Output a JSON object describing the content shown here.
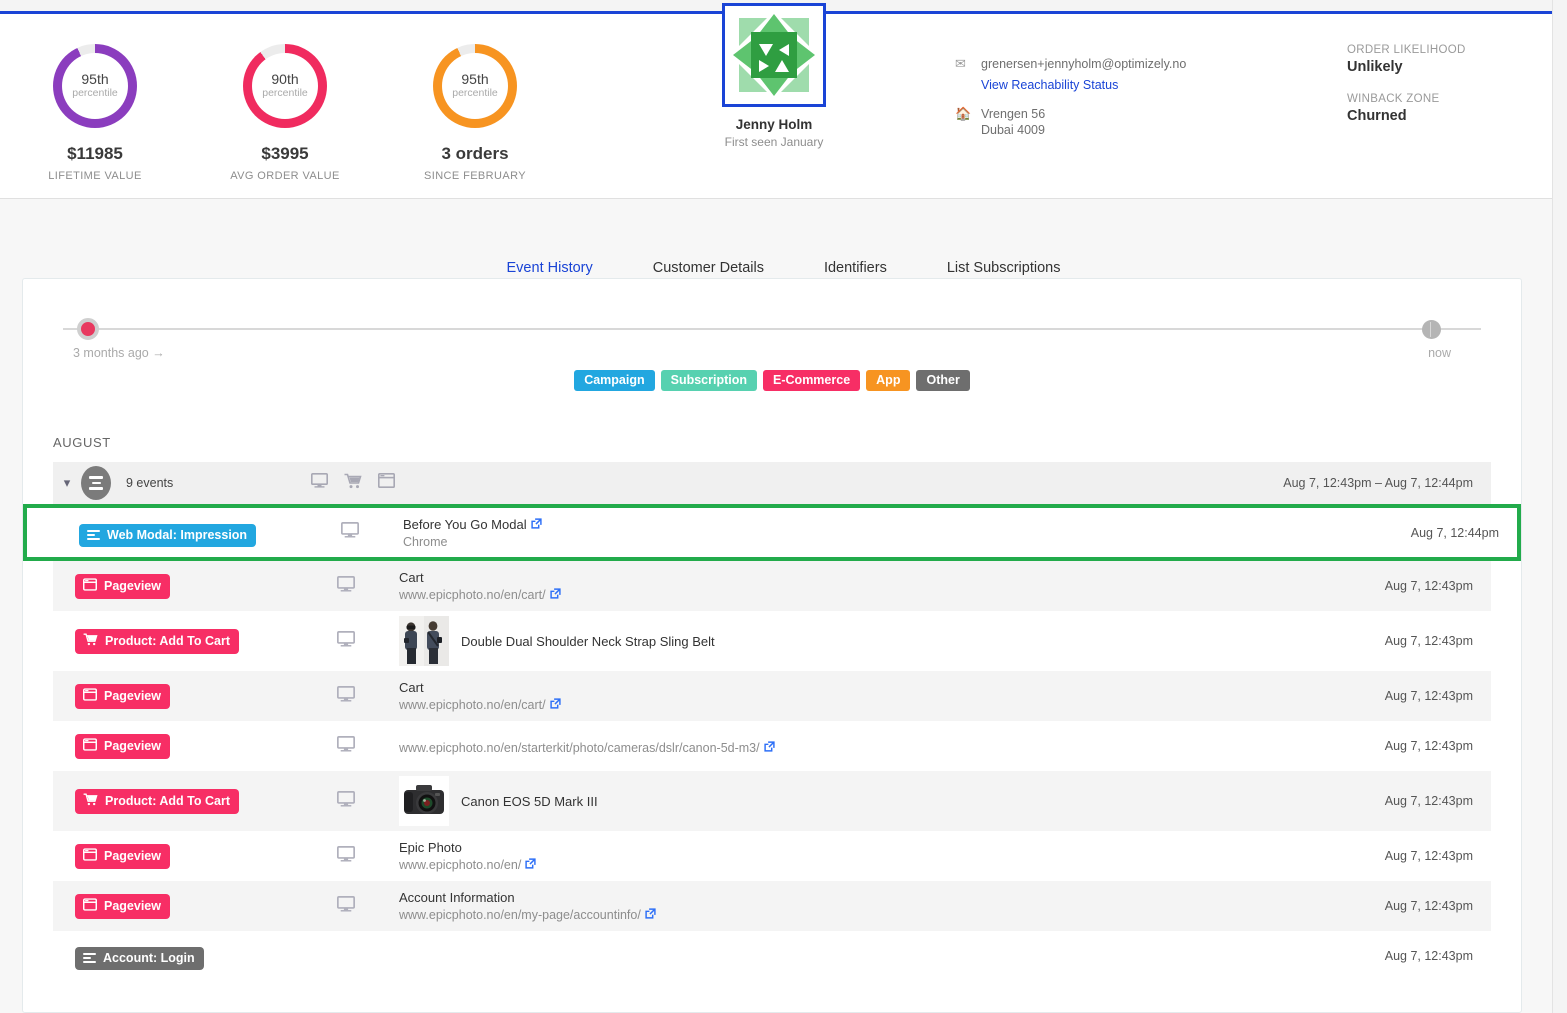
{
  "header": {
    "metrics": [
      {
        "pct": "95th",
        "pct_sub": "percentile",
        "value": "$11985",
        "caption": "LIFETIME VALUE",
        "color": "#8B3DBE",
        "fill": 0.93
      },
      {
        "pct": "90th",
        "pct_sub": "percentile",
        "value": "$3995",
        "caption": "AVG ORDER VALUE",
        "color": "#F02B5F",
        "fill": 0.9
      },
      {
        "pct": "95th",
        "pct_sub": "percentile",
        "value": "3 orders",
        "caption": "SINCE FEBRUARY",
        "color": "#F79421",
        "fill": 0.93
      }
    ],
    "identity": {
      "name": "Jenny Holm",
      "first_seen": "First seen January"
    },
    "contact": {
      "email": "grenersen+jennyholm@optimizely.no",
      "reachability_link": "View Reachability Status",
      "address_line1": "Vrengen 56",
      "address_line2": "Dubai 4009"
    },
    "stats": [
      {
        "label": "ORDER LIKELIHOOD",
        "value": "Unlikely"
      },
      {
        "label": "WINBACK ZONE",
        "value": "Churned"
      }
    ]
  },
  "tabs": [
    {
      "label": "Event History",
      "active": true
    },
    {
      "label": "Customer Details",
      "active": false
    },
    {
      "label": "Identifiers",
      "active": false
    },
    {
      "label": "List Subscriptions",
      "active": false
    }
  ],
  "timeline": {
    "start_label": "3 months ago  →",
    "end_label": "now"
  },
  "filters": [
    {
      "label": "Campaign",
      "color": "#22A7E0"
    },
    {
      "label": "Subscription",
      "color": "#57D1B0"
    },
    {
      "label": "E-Commerce",
      "color": "#F72E65"
    },
    {
      "label": "App",
      "color": "#F79421"
    },
    {
      "label": "Other",
      "color": "#6E6E6E"
    }
  ],
  "month_label": "AUGUST",
  "group": {
    "count_label": "9 events",
    "time_range": "Aug 7, 12:43pm – Aug 7, 12:44pm"
  },
  "events": [
    {
      "badge": "Web Modal: Impression",
      "badge_color": "#22A7E0",
      "badge_icon": "hamburger-icon",
      "title": "Before You Go Modal",
      "sub": "Chrome",
      "has_extlink_title": true,
      "time": "Aug 7, 12:44pm",
      "highlight": true,
      "device": "monitor-icon"
    },
    {
      "badge": "Pageview",
      "badge_color": "#F72E65",
      "badge_icon": "browser-window-icon",
      "title": "Cart",
      "sub": "www.epicphoto.no/en/cart/",
      "has_extlink_sub": true,
      "time": "Aug 7, 12:43pm",
      "alt": true,
      "device": "monitor-icon"
    },
    {
      "badge": "Product: Add To Cart",
      "badge_color": "#F72E65",
      "badge_icon": "cart-icon",
      "product": "Double Dual Shoulder Neck Strap Sling Belt",
      "thumb": "people-photo",
      "time": "Aug 7, 12:43pm",
      "alt": false,
      "device": "monitor-icon"
    },
    {
      "badge": "Pageview",
      "badge_color": "#F72E65",
      "badge_icon": "browser-window-icon",
      "title": "Cart",
      "sub": "www.epicphoto.no/en/cart/",
      "has_extlink_sub": true,
      "time": "Aug 7, 12:43pm",
      "alt": true,
      "device": "monitor-icon"
    },
    {
      "badge": "Pageview",
      "badge_color": "#F72E65",
      "badge_icon": "browser-window-icon",
      "sub": "www.epicphoto.no/en/starterkit/photo/cameras/dslr/canon-5d-m3/",
      "has_extlink_sub": true,
      "time": "Aug 7, 12:43pm",
      "alt": false,
      "device": "monitor-icon"
    },
    {
      "badge": "Product: Add To Cart",
      "badge_color": "#F72E65",
      "badge_icon": "cart-icon",
      "product": "Canon EOS 5D Mark III",
      "thumb": "camera-photo",
      "time": "Aug 7, 12:43pm",
      "alt": true,
      "device": "monitor-icon"
    },
    {
      "badge": "Pageview",
      "badge_color": "#F72E65",
      "badge_icon": "browser-window-icon",
      "title": "Epic Photo",
      "sub": "www.epicphoto.no/en/",
      "has_extlink_sub": true,
      "time": "Aug 7, 12:43pm",
      "alt": false,
      "device": "monitor-icon"
    },
    {
      "badge": "Pageview",
      "badge_color": "#F72E65",
      "badge_icon": "browser-window-icon",
      "title": "Account Information",
      "sub": "www.epicphoto.no/en/my-page/accountinfo/",
      "has_extlink_sub": true,
      "time": "Aug 7, 12:43pm",
      "alt": true,
      "device": "monitor-icon"
    },
    {
      "badge": "Account: Login",
      "badge_color": "#6E6E6E",
      "badge_icon": "hamburger-icon",
      "time": "Aug 7, 12:43pm",
      "alt": false,
      "device": null
    }
  ]
}
